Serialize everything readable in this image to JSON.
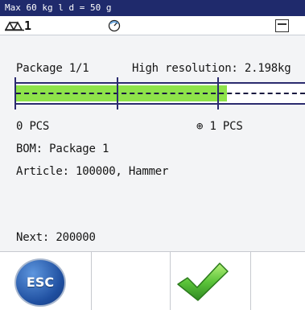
{
  "header": {
    "capacity": "Max 60 kg  l d = 50 g"
  },
  "weigh_bar": {
    "scale_number": "1",
    "scale_icon": "scale-icon",
    "dial_icon": "dial-icon",
    "menu_icon": "menu-icon"
  },
  "main": {
    "package_label": "Package 1/1",
    "resolution_label": "High resolution: 2.198kg",
    "bar": {
      "fill_fraction": 0.73,
      "color_fill": "#8ee34a",
      "color_frame": "#2b2b6f"
    },
    "left_pcs": "0 PCS",
    "target_pcs": "⊕ 1 PCS",
    "bom": "BOM: Package  1",
    "article": "Article: 100000, Hammer",
    "next": "Next: 200000"
  },
  "softkeys": {
    "esc_label": "ESC",
    "esc_icon": "esc-icon",
    "ok_icon": "check-icon"
  }
}
